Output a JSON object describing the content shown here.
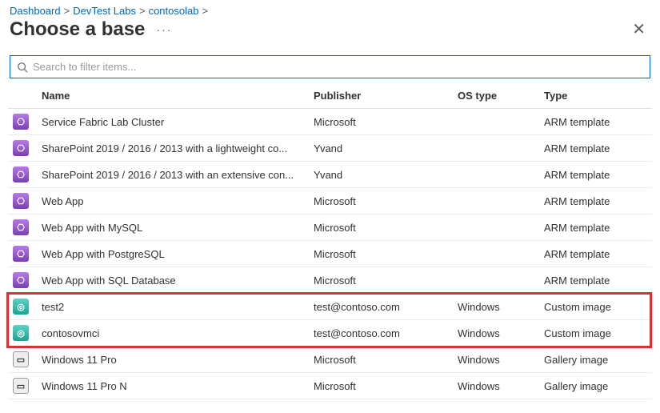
{
  "breadcrumb": [
    {
      "label": "Dashboard"
    },
    {
      "label": "DevTest Labs"
    },
    {
      "label": "contosolab"
    }
  ],
  "title": "Choose a base",
  "search": {
    "placeholder": "Search to filter items...",
    "value": ""
  },
  "columns": {
    "name": "Name",
    "publisher": "Publisher",
    "os": "OS type",
    "type": "Type"
  },
  "rows": [
    {
      "icon": "arm",
      "name": "Service Fabric Lab Cluster",
      "publisher": "Microsoft",
      "os": "",
      "type": "ARM template"
    },
    {
      "icon": "arm",
      "name": "SharePoint 2019 / 2016 / 2013 with a lightweight co...",
      "publisher": "Yvand",
      "os": "",
      "type": "ARM template"
    },
    {
      "icon": "arm",
      "name": "SharePoint 2019 / 2016 / 2013 with an extensive con...",
      "publisher": "Yvand",
      "os": "",
      "type": "ARM template"
    },
    {
      "icon": "arm",
      "name": "Web App",
      "publisher": "Microsoft",
      "os": "",
      "type": "ARM template"
    },
    {
      "icon": "arm",
      "name": "Web App with MySQL",
      "publisher": "Microsoft",
      "os": "",
      "type": "ARM template"
    },
    {
      "icon": "arm",
      "name": "Web App with PostgreSQL",
      "publisher": "Microsoft",
      "os": "",
      "type": "ARM template"
    },
    {
      "icon": "arm",
      "name": "Web App with SQL Database",
      "publisher": "Microsoft",
      "os": "",
      "type": "ARM template"
    },
    {
      "icon": "custom",
      "name": "test2",
      "publisher": "test@contoso.com",
      "os": "Windows",
      "type": "Custom image",
      "hl": true
    },
    {
      "icon": "custom",
      "name": "contosovmci",
      "publisher": "test@contoso.com",
      "os": "Windows",
      "type": "Custom image",
      "hl": true
    },
    {
      "icon": "gallery",
      "name": "Windows 11 Pro",
      "publisher": "Microsoft",
      "os": "Windows",
      "type": "Gallery image"
    },
    {
      "icon": "gallery",
      "name": "Windows 11 Pro N",
      "publisher": "Microsoft",
      "os": "Windows",
      "type": "Gallery image"
    }
  ],
  "icon_glyph": {
    "arm": "⎔",
    "custom": "◎",
    "gallery": "▭"
  }
}
